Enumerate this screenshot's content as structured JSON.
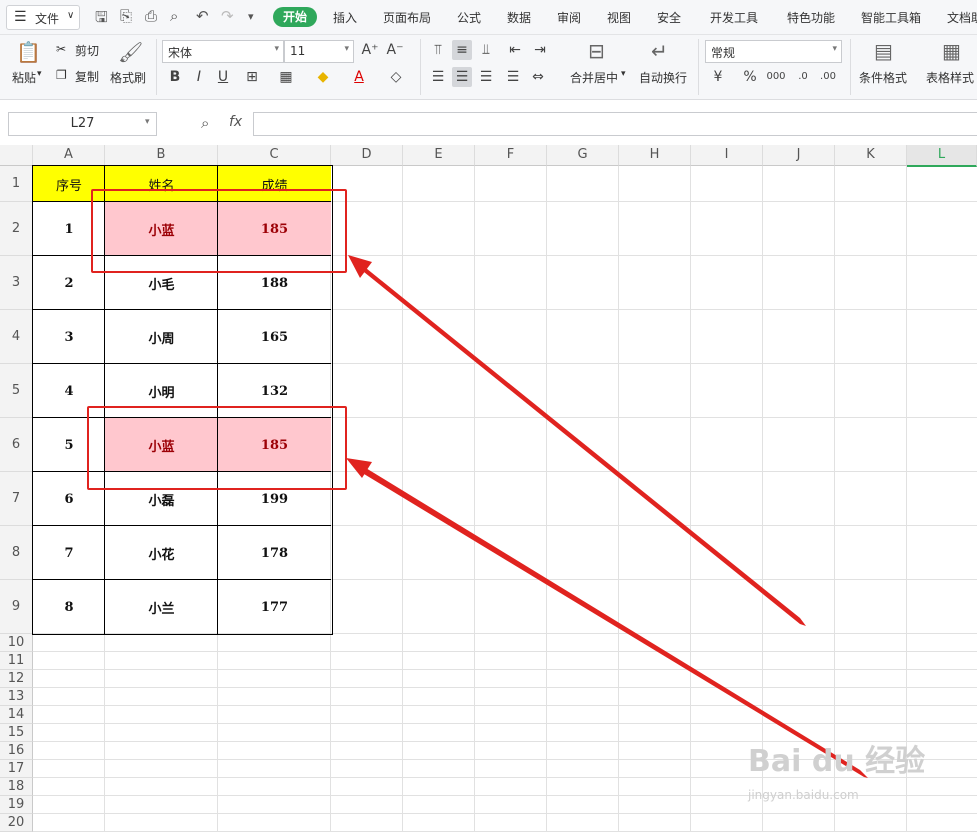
{
  "menu": {
    "file": "文件",
    "tabs": [
      "开始",
      "插入",
      "页面布局",
      "公式",
      "数据",
      "审阅",
      "视图",
      "安全",
      "开发工具",
      "特色功能",
      "智能工具箱",
      "文档助"
    ],
    "active_tab": "开始",
    "accent": "#2fa85b"
  },
  "ribbon": {
    "cut": "剪切",
    "copy": "复制",
    "paste": "粘贴",
    "format_painter": "格式刷",
    "font_name": "宋体",
    "font_size": "11",
    "merge_center": "合并居中",
    "wrap_text": "自动换行",
    "number_format": "常规",
    "conditional_format": "条件格式",
    "table_style": "表格样式"
  },
  "formula_bar": {
    "name_box": "L27",
    "fx": "fx",
    "content": ""
  },
  "sheet": {
    "columns": [
      "A",
      "B",
      "C",
      "D",
      "E",
      "F",
      "G",
      "H",
      "I",
      "J",
      "K",
      "L"
    ],
    "rows": [
      "1",
      "2",
      "3",
      "4",
      "5",
      "6",
      "7",
      "8",
      "9",
      "10",
      "11",
      "12",
      "13",
      "14",
      "15",
      "16",
      "17",
      "18",
      "19",
      "20"
    ],
    "headers": [
      "序号",
      "姓名",
      "成绩"
    ],
    "data": [
      [
        "1",
        "小蓝",
        "185"
      ],
      [
        "2",
        "小毛",
        "188"
      ],
      [
        "3",
        "小周",
        "165"
      ],
      [
        "4",
        "小明",
        "132"
      ],
      [
        "5",
        "小蓝",
        "185"
      ],
      [
        "6",
        "小磊",
        "199"
      ],
      [
        "7",
        "小花",
        "178"
      ],
      [
        "8",
        "小兰",
        "177"
      ]
    ],
    "duplicate_rows": [
      0,
      4
    ],
    "header_fill": "#ffff00",
    "duplicate_fill": "#ffc7ce",
    "duplicate_text": "#9c0006"
  },
  "annotation_color": "#e0231f",
  "watermark": {
    "brand": "Bai du 经验",
    "url": "jingyan.baidu.com"
  }
}
